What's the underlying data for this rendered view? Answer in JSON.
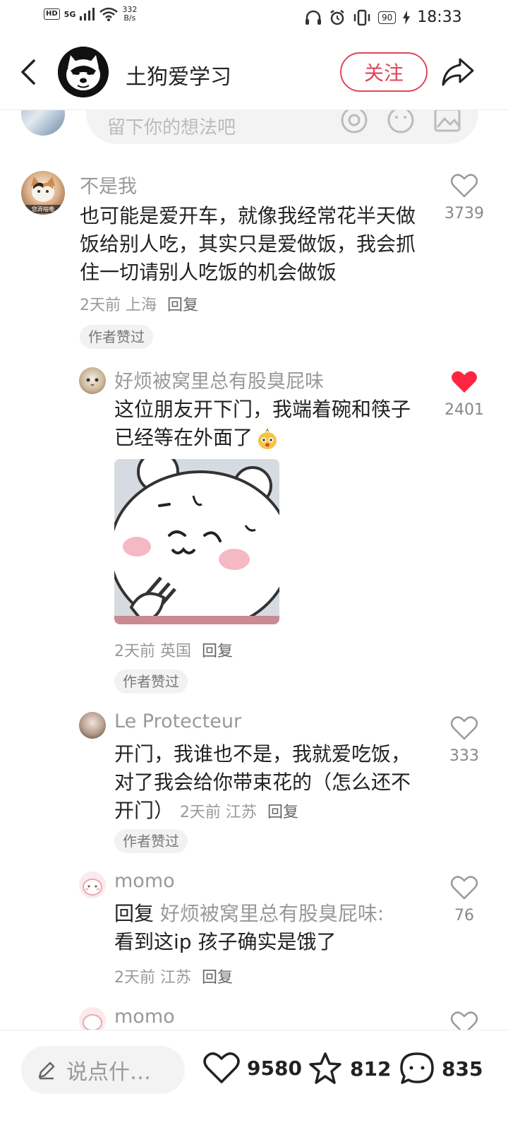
{
  "status_bar": {
    "hd": "HD",
    "network": "5G",
    "speed_value": "332",
    "speed_unit": "B/s",
    "battery": "90",
    "time": "18:33"
  },
  "header": {
    "title": "土狗爱学习",
    "follow_label": "关注"
  },
  "comment_input": {
    "placeholder": "留下你的想法吧"
  },
  "comments": [
    {
      "name": "不是我",
      "avatar_caption": "您弄啥嘞",
      "text": "也可能是爱开车，就像我经常花半天做饭给别人吃，其实只是爱做饭，我会抓住一切请别人吃饭的机会做饭",
      "time": "2天前",
      "location": "上海",
      "reply_label": "回复",
      "badge": "作者赞过",
      "likes": "3739",
      "liked": false
    },
    {
      "name": "好烦被窝里总有股臭屁味",
      "text": "这位朋友开下门，我端着碗和筷子已经等在外面了",
      "time": "2天前",
      "location": "英国",
      "reply_label": "回复",
      "badge": "作者赞过",
      "likes": "2401",
      "liked": true
    },
    {
      "name": "Le Protecteur",
      "text": "开门，我谁也不是，我就爱吃饭，对了我会给你带束花的（怎么还不开门）",
      "time": "2天前",
      "location": "江苏",
      "reply_label": "回复",
      "badge": "作者赞过",
      "likes": "333",
      "liked": false
    },
    {
      "name": "momo",
      "reply_prefix": "回复",
      "reply_to": "好烦被窝里总有股臭屁味:",
      "text": "看到这ip 孩子确实是饿了",
      "time": "2天前",
      "location": "江苏",
      "reply_label": "回复",
      "likes": "76",
      "liked": false
    },
    {
      "name": "momo"
    }
  ],
  "bottom_bar": {
    "input_placeholder": "说点什…",
    "likes": "9580",
    "stars": "812",
    "comments": "835"
  },
  "colors": {
    "accent": "#e0465a",
    "liked_heart": "#ff2442",
    "muted": "#999999"
  }
}
